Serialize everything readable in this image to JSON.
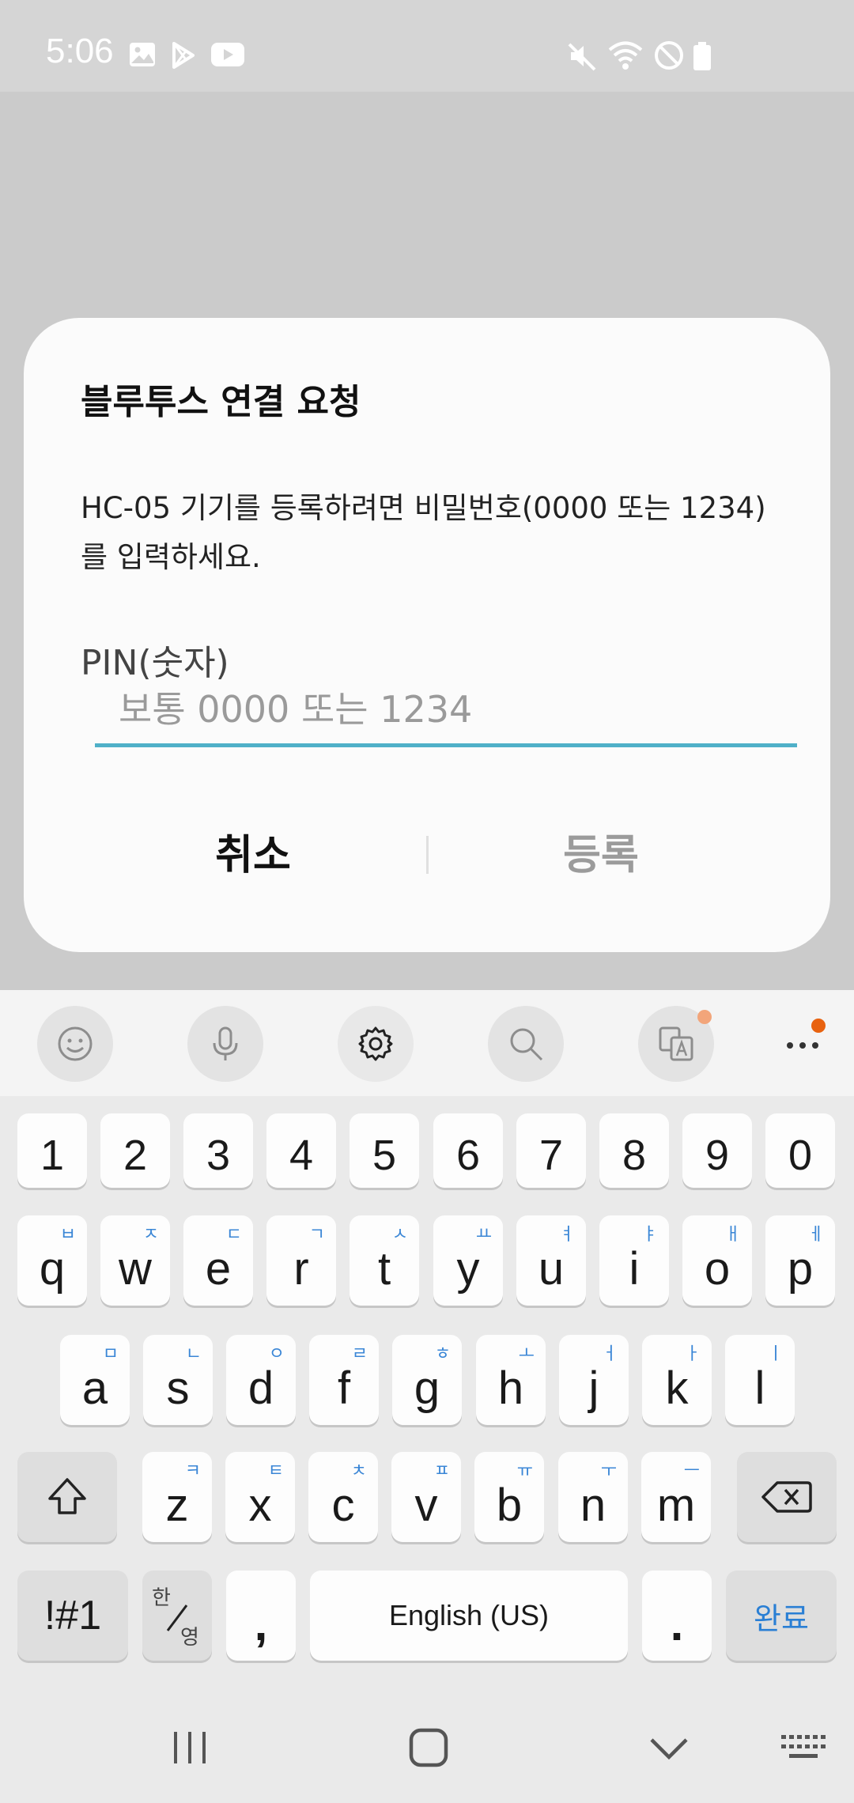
{
  "status_bar": {
    "time": "5:06",
    "left_icons": [
      "gallery-icon",
      "play-store-icon",
      "youtube-icon"
    ],
    "right_icons": [
      "mute-icon",
      "wifi-icon",
      "do-not-disturb-icon",
      "battery-icon"
    ]
  },
  "dialog": {
    "title": "블루투스 연결 요청",
    "message": "HC-05 기기를 등록하려면 비밀번호(0000 또는 1234)를 입력하세요.",
    "pin_label": "PIN(숫자)",
    "pin_placeholder": "보통 0000 또는 1234",
    "pin_value": "",
    "cancel_label": "취소",
    "register_label": "등록"
  },
  "keyboard": {
    "toolbar": [
      "emoji-icon",
      "microphone-icon",
      "settings-icon",
      "search-icon",
      "translate-icon",
      "more-icon"
    ],
    "number_row": [
      "1",
      "2",
      "3",
      "4",
      "5",
      "6",
      "7",
      "8",
      "9",
      "0"
    ],
    "row1": [
      {
        "key": "q",
        "hangul": "ㅂ"
      },
      {
        "key": "w",
        "hangul": "ㅈ"
      },
      {
        "key": "e",
        "hangul": "ㄷ"
      },
      {
        "key": "r",
        "hangul": "ㄱ"
      },
      {
        "key": "t",
        "hangul": "ㅅ"
      },
      {
        "key": "y",
        "hangul": "ㅛ"
      },
      {
        "key": "u",
        "hangul": "ㅕ"
      },
      {
        "key": "i",
        "hangul": "ㅑ"
      },
      {
        "key": "o",
        "hangul": "ㅐ"
      },
      {
        "key": "p",
        "hangul": "ㅔ"
      }
    ],
    "row2": [
      {
        "key": "a",
        "hangul": "ㅁ"
      },
      {
        "key": "s",
        "hangul": "ㄴ"
      },
      {
        "key": "d",
        "hangul": "ㅇ"
      },
      {
        "key": "f",
        "hangul": "ㄹ"
      },
      {
        "key": "g",
        "hangul": "ㅎ"
      },
      {
        "key": "h",
        "hangul": "ㅗ"
      },
      {
        "key": "j",
        "hangul": "ㅓ"
      },
      {
        "key": "k",
        "hangul": "ㅏ"
      },
      {
        "key": "l",
        "hangul": "ㅣ"
      }
    ],
    "row3": [
      {
        "key": "z",
        "hangul": "ㅋ"
      },
      {
        "key": "x",
        "hangul": "ㅌ"
      },
      {
        "key": "c",
        "hangul": "ㅊ"
      },
      {
        "key": "v",
        "hangul": "ㅍ"
      },
      {
        "key": "b",
        "hangul": "ㅠ"
      },
      {
        "key": "n",
        "hangul": "ㅜ"
      },
      {
        "key": "m",
        "hangul": "ㅡ"
      }
    ],
    "symbols_label": "!#1",
    "lang_top": "한",
    "lang_bottom": "영",
    "comma_label": ",",
    "space_label": "English (US)",
    "period_label": ".",
    "done_label": "완료"
  },
  "colors": {
    "accent": "#4fb0c8",
    "done_text": "#2a7fd4",
    "notification_dot": "#e8620f"
  }
}
